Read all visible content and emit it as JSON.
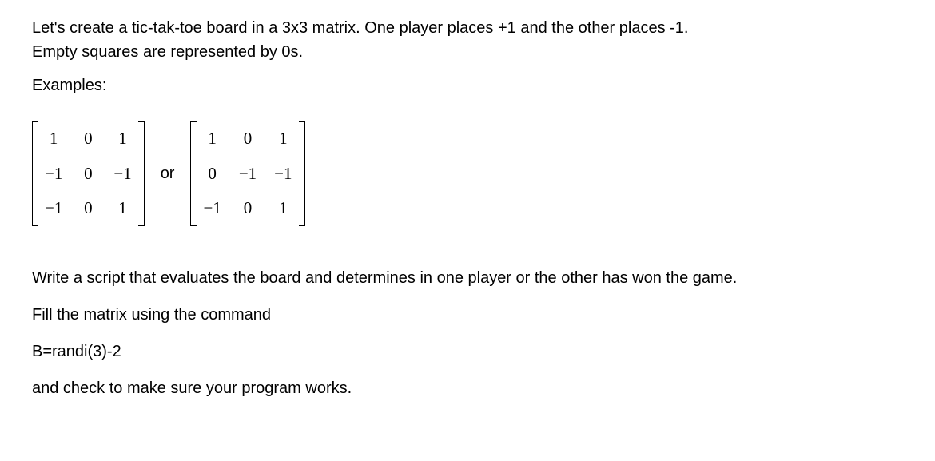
{
  "intro": {
    "line1": "Let's create a tic-tak-toe board in a 3x3 matrix.  One player places +1 and the other places -1.",
    "line2": "Empty squares are represented by 0s."
  },
  "examples_label": "Examples:",
  "matrices": {
    "m1": {
      "r0c0": "1",
      "r0c1": "0",
      "r0c2": "1",
      "r1c0": "−1",
      "r1c1": "0",
      "r1c2": "−1",
      "r2c0": "−1",
      "r2c1": "0",
      "r2c2": "1"
    },
    "or": "or",
    "m2": {
      "r0c0": "1",
      "r0c1": "0",
      "r0c2": "1",
      "r1c0": "0",
      "r1c1": "−1",
      "r1c2": "−1",
      "r2c0": "−1",
      "r2c1": "0",
      "r2c2": "1"
    }
  },
  "instructions": {
    "line1": "Write a script that evaluates the board and determines in one player or the other has won the game.",
    "line2": "Fill the matrix using the command",
    "line3": "B=randi(3)-2",
    "line4": "and check to make sure your program works."
  }
}
